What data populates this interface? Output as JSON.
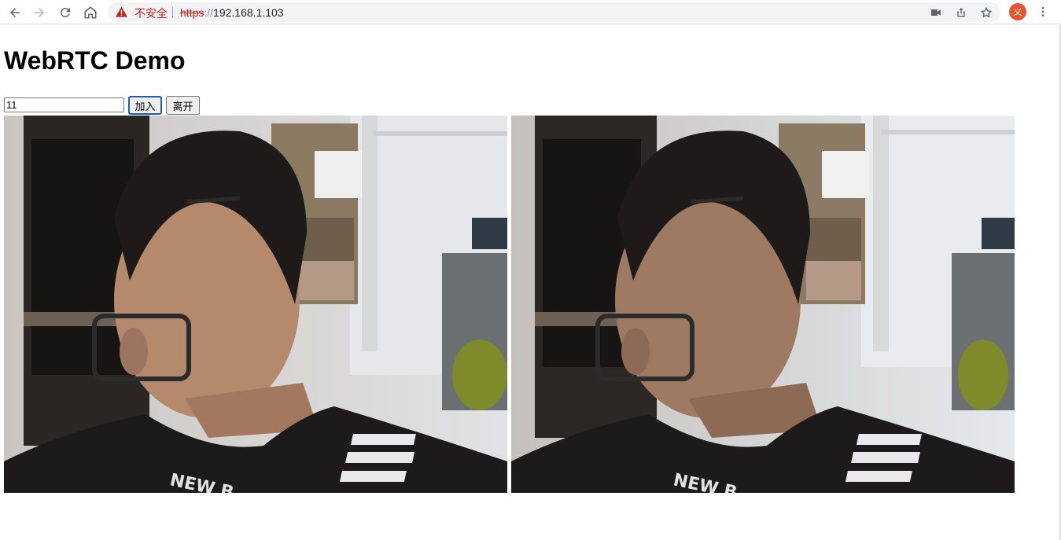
{
  "browser": {
    "insecure_label": "不安全",
    "url_scheme": "https",
    "url_separator": "://",
    "url_host": "192.168.1.103",
    "avatar_letter": "义"
  },
  "page": {
    "title": "WebRTC Demo",
    "room_input_value": "11",
    "join_label": "加入",
    "leave_label": "离开"
  },
  "videos": {
    "local_name": "local-video",
    "remote_name": "remote-video",
    "brand_text": "NEW B"
  },
  "colors": {
    "warning_red": "#c5221f",
    "avatar": "#e8542b",
    "shirt": "#1c1a1b"
  }
}
